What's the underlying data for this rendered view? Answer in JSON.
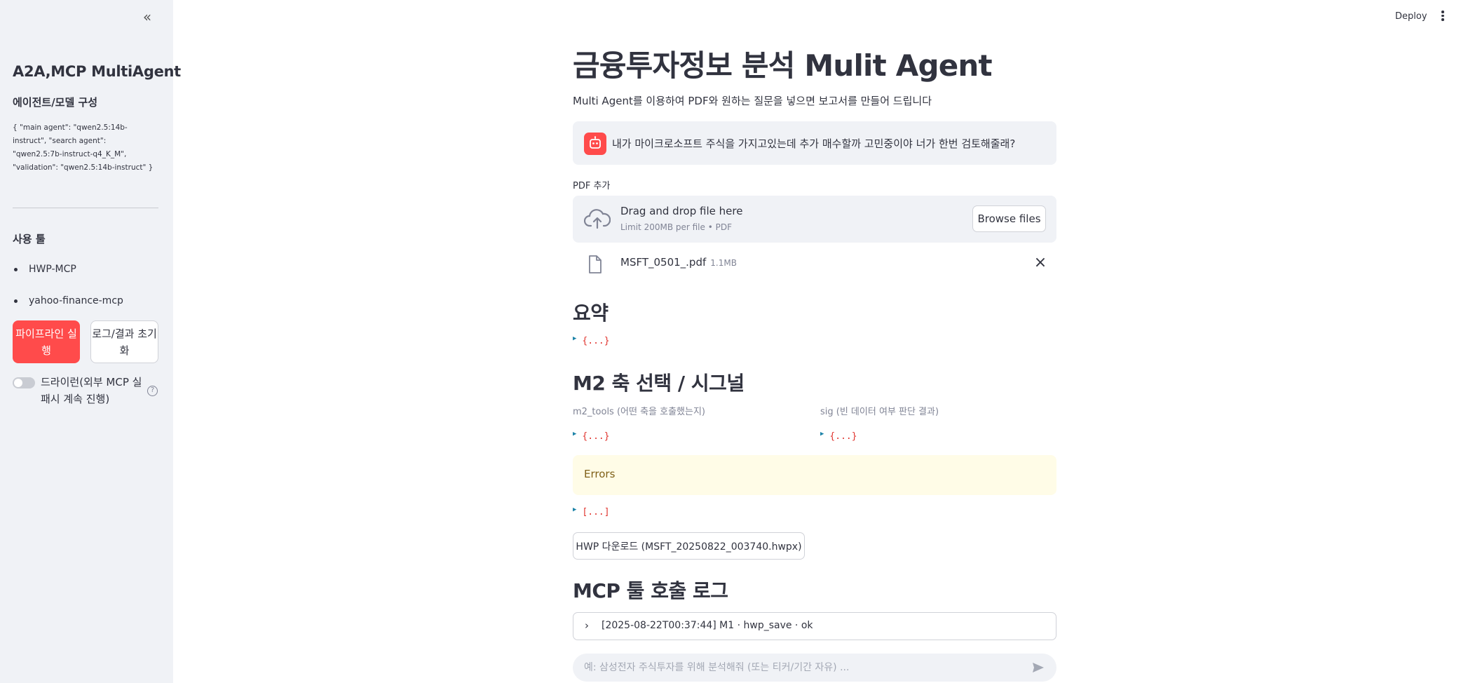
{
  "sidebar": {
    "collapse_icon": "double-chevron-left-icon",
    "title": "A2A,MCP MultiAgent",
    "config_title": "에이전트/모델 구성",
    "config_json": "{ \"main agent\": \"qwen2.5:14b-instruct\", \"search agent\": \"qwen2.5:7b-instruct-q4_K_M\", \"validation\": \"qwen2.5:14b-instruct\" }",
    "tools_title": "사용 툴",
    "tools": [
      "HWP-MCP",
      "yahoo-finance-mcp"
    ],
    "run_button": "파이프라인 실행",
    "reset_button": "로그/결과 초기화",
    "dryrun_label": "드라이런(외부 MCP 실패시 계속 진행)",
    "dryrun_enabled": false
  },
  "header": {
    "deploy_label": "Deploy",
    "menu_icon": "vertical-dots-icon"
  },
  "main": {
    "title": "금융투자정보 분석 Mulit Agent",
    "description": "Multi Agent를 이용하여 PDF와 원하는 질문을 넣으면 보고서를 만들어 드립니다",
    "chat_message": "내가 마이크로소프트 주식을 가지고있는데 추가 매수할까 고민중이야 너가 한번 검토해줄래?",
    "pdf_label": "PDF 추가",
    "dropzone_title": "Drag and drop file here",
    "dropzone_sub": "Limit 200MB per file • PDF",
    "browse_label": "Browse files",
    "file_name": "MSFT_0501_.pdf",
    "file_size": "1.1MB",
    "summary_title": "요약",
    "json_obj": "{...}",
    "json_arr": "[...]",
    "m2_title": "M2 축 선택 / 시그널",
    "m2_tools_caption": "m2_tools (어떤 축을 호출했는지)",
    "sig_caption": "sig (빈 데이터 여부 판단 결과)",
    "errors_label": "Errors",
    "download_label": "HWP 다운로드 (MSFT_20250822_003740.hwpx)",
    "log_title": "MCP 툴 호출 로그",
    "log_entry": "[2025-08-22T00:37:44] M1 · hwp_save · ok",
    "chat_placeholder": "예: 삼성전자 주식투자를 위해 분석해줘 (또는 티커/기간 자유) ..."
  },
  "colors": {
    "primary": "#ff4b4b",
    "sidebar_bg": "#f0f2f6",
    "warning_bg": "#fffce7",
    "warning_text": "#7f6018"
  }
}
